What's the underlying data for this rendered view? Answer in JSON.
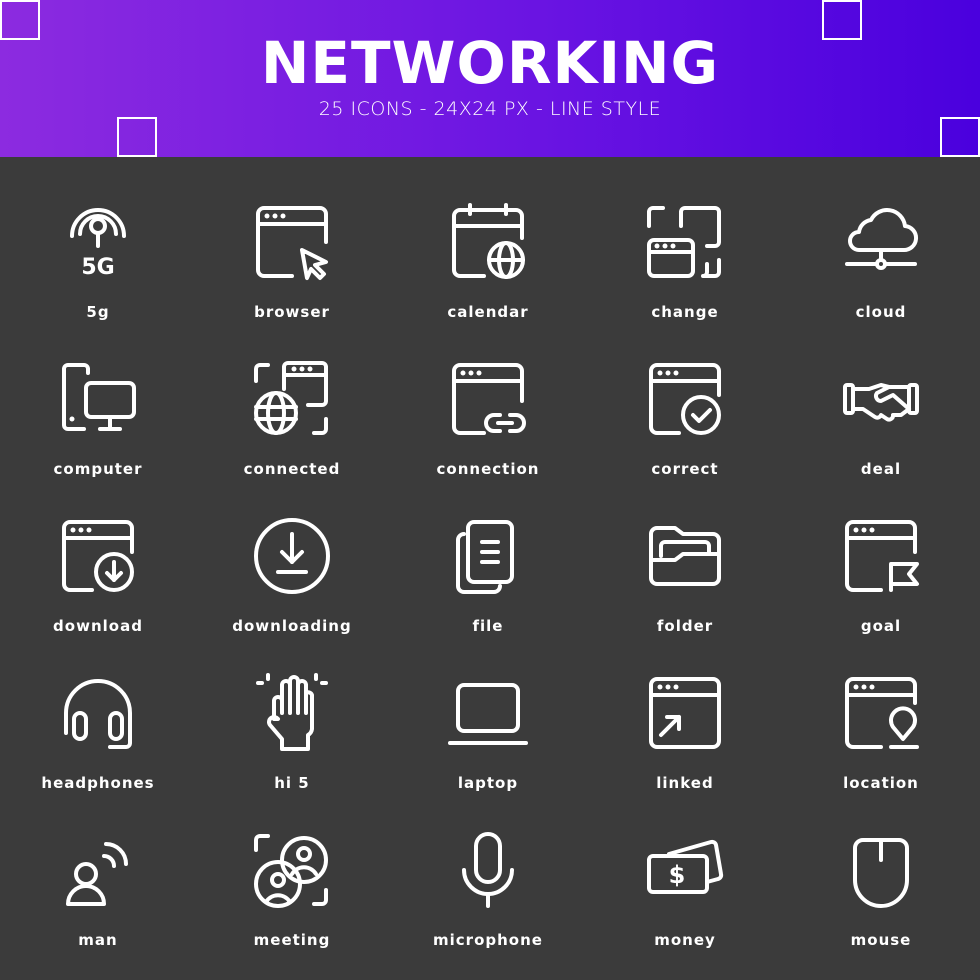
{
  "header": {
    "title": "NETWORKING",
    "subtitle": "25 ICONS - 24X24 PX - LINE STYLE",
    "gradient_start": "#8c2be0",
    "gradient_end": "#4a00de"
  },
  "background_color": "#3b3b3b",
  "icon_color": "#ffffff",
  "icons": [
    {
      "label": "5g",
      "icon": "5g-signal-icon",
      "badge": "5G"
    },
    {
      "label": "browser",
      "icon": "browser-cursor-icon"
    },
    {
      "label": "calendar",
      "icon": "calendar-globe-icon"
    },
    {
      "label": "change",
      "icon": "change-window-icon"
    },
    {
      "label": "cloud",
      "icon": "cloud-network-icon"
    },
    {
      "label": "computer",
      "icon": "computer-devices-icon"
    },
    {
      "label": "connected",
      "icon": "connected-globe-icon"
    },
    {
      "label": "connection",
      "icon": "connection-link-icon"
    },
    {
      "label": "correct",
      "icon": "correct-check-icon"
    },
    {
      "label": "deal",
      "icon": "handshake-icon"
    },
    {
      "label": "download",
      "icon": "download-window-icon"
    },
    {
      "label": "downloading",
      "icon": "downloading-circle-icon"
    },
    {
      "label": "file",
      "icon": "file-copy-icon"
    },
    {
      "label": "folder",
      "icon": "folder-open-icon"
    },
    {
      "label": "goal",
      "icon": "goal-flag-icon"
    },
    {
      "label": "headphones",
      "icon": "headphones-icon"
    },
    {
      "label": "hi 5",
      "icon": "high-five-hand-icon"
    },
    {
      "label": "laptop",
      "icon": "laptop-icon"
    },
    {
      "label": "linked",
      "icon": "linked-arrow-icon"
    },
    {
      "label": "location",
      "icon": "location-pin-icon"
    },
    {
      "label": "man",
      "icon": "man-signal-icon"
    },
    {
      "label": "meeting",
      "icon": "meeting-users-icon"
    },
    {
      "label": "microphone",
      "icon": "microphone-icon"
    },
    {
      "label": "money",
      "icon": "money-dollar-icon",
      "symbol": "$"
    },
    {
      "label": "mouse",
      "icon": "mouse-icon"
    }
  ]
}
